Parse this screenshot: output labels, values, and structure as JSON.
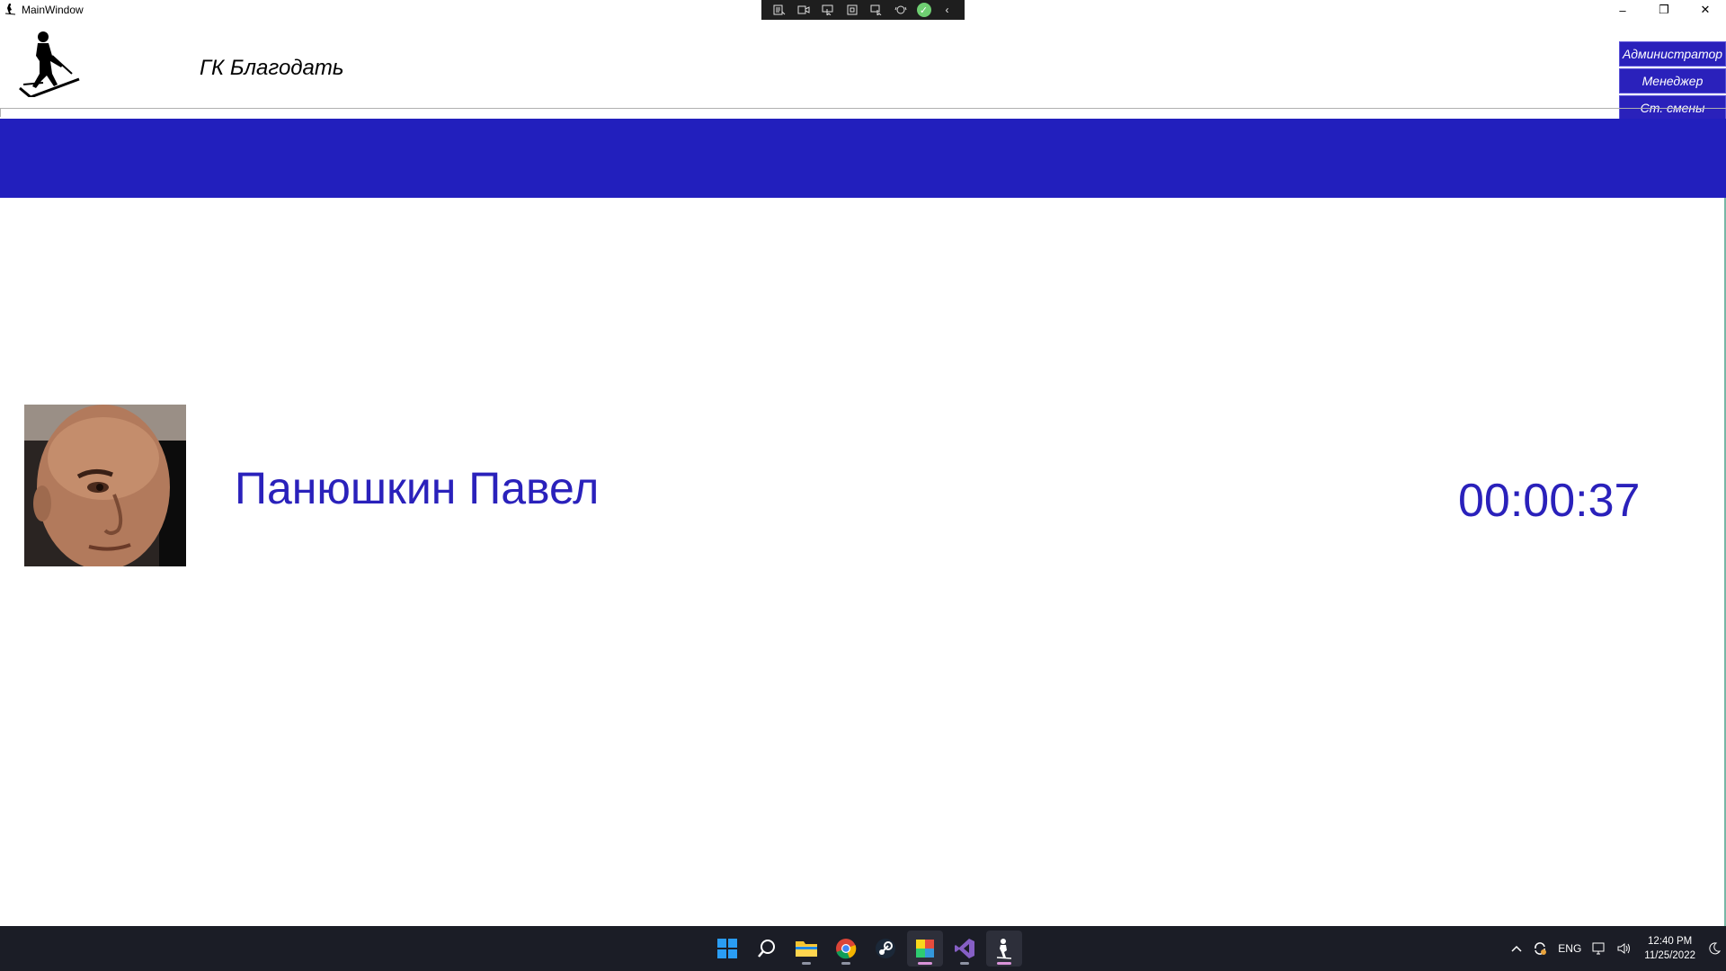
{
  "window": {
    "title": "MainWindow",
    "minimize_label": "–",
    "restore_label": "❐",
    "close_label": "✕"
  },
  "debug_toolbar": {
    "items": [
      "live-tree",
      "record",
      "select-element",
      "display-layout-adorners",
      "track-focus",
      "hot-reload",
      "check",
      "collapse"
    ]
  },
  "header": {
    "company_name": "ГК Благодать",
    "roles": [
      "Администратор",
      "Менеджер",
      "Ст. смены"
    ]
  },
  "employee": {
    "name": "Панюшкин Павел",
    "elapsed": "00:00:37"
  },
  "colors": {
    "accent": "#221fbd",
    "text_accent": "#2a21bb",
    "taskbar": "#1b1d26"
  },
  "taskbar": {
    "apps": [
      "start",
      "search",
      "file-explorer",
      "chrome",
      "steam",
      "sticky-app",
      "visual-studio",
      "running-app"
    ],
    "tray": {
      "language": "ENG",
      "time": "12:40 PM",
      "date": "11/25/2022"
    }
  }
}
